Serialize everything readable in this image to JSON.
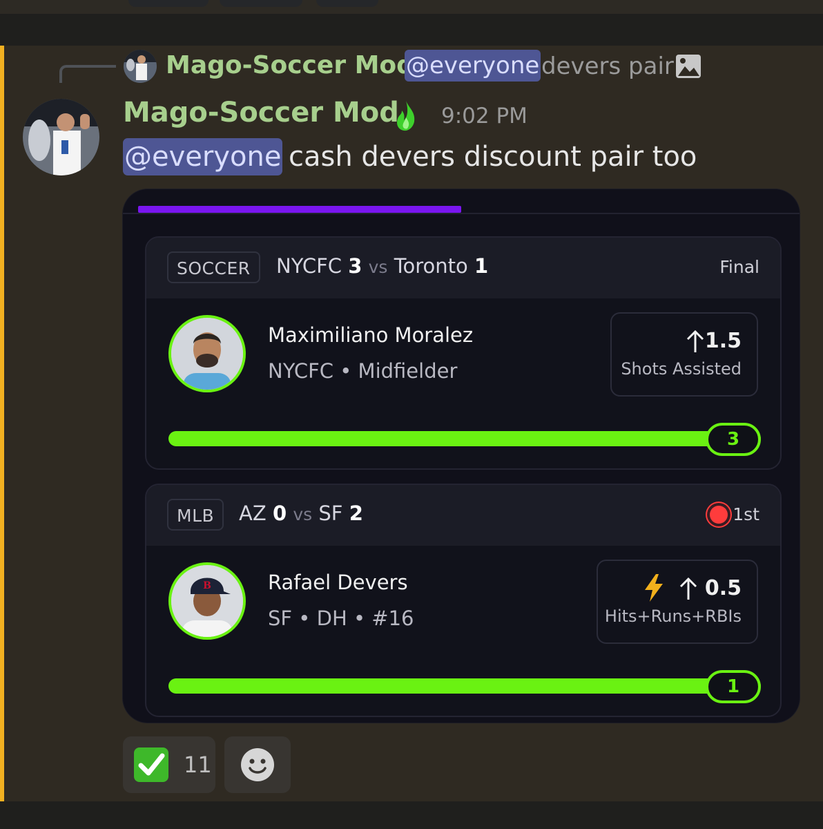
{
  "reply": {
    "author": "Mago-Soccer Mod",
    "mention": "@everyone",
    "text": "devers pair",
    "attachment_icon": "image-icon"
  },
  "message": {
    "author": "Mago-Soccer Mod",
    "badge_icon": "green-flame-icon",
    "timestamp": "9:02 PM",
    "mention": "@everyone",
    "text": "cash devers discount pair too"
  },
  "embed": {
    "progress_fraction": 0.5,
    "accent_color": "#7a16f0",
    "stat_color": "#6af212",
    "picks": [
      {
        "league": "SOCCER",
        "team1": "NYCFC",
        "score1": "3",
        "vs": "vs",
        "team2": "Toronto",
        "score2": "1",
        "status": "Final",
        "player_name": "Maximiliano Moralez",
        "player_info": "NYCFC • Midfielder",
        "line": "1.5",
        "stat_label": "Shots Assisted",
        "current": "3"
      },
      {
        "league": "MLB",
        "team1": "AZ",
        "score1": "0",
        "vs": "vs",
        "team2": "SF",
        "score2": "2",
        "status": "1st",
        "live_icon": "live-dot-icon",
        "player_name": "Rafael Devers",
        "player_info": "SF • DH • #16",
        "line": "0.5",
        "stat_label": "Hits+Runs+RBIs",
        "boost_icon": "lightning-bolt-icon",
        "current": "1"
      }
    ]
  },
  "reactions": [
    {
      "icon": "white-check-mark-icon",
      "count": "11"
    },
    {
      "icon": "add-reaction-icon"
    }
  ]
}
